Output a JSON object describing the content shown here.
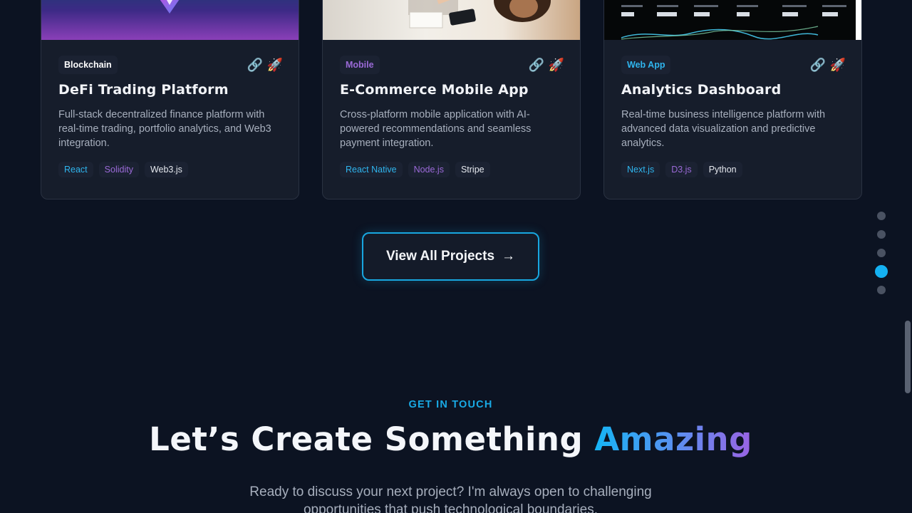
{
  "projects": [
    {
      "category": "Blockchain",
      "category_color": "#ffffff",
      "category_bg": "#1b2232",
      "title": "DeFi Trading Platform",
      "description": "Full-stack decentralized finance platform with real-time trading, portfolio analytics, and Web3 integration.",
      "tags": [
        {
          "label": "React",
          "color": "#2fb5ee"
        },
        {
          "label": "Solidity",
          "color": "#9b6ad8"
        },
        {
          "label": "Web3.js",
          "color": "#e5e8ee"
        }
      ],
      "thumb": "defi"
    },
    {
      "category": "Mobile",
      "category_color": "#9b6ad8",
      "category_bg": "#1b2232",
      "title": "E-Commerce Mobile App",
      "description": "Cross-platform mobile application with AI-powered recommendations and seamless payment integration.",
      "tags": [
        {
          "label": "React Native",
          "color": "#2fb5ee"
        },
        {
          "label": "Node.js",
          "color": "#9b6ad8"
        },
        {
          "label": "Stripe",
          "color": "#e5e8ee"
        }
      ],
      "thumb": "shop"
    },
    {
      "category": "Web App",
      "category_color": "#2fb5ee",
      "category_bg": "#1b2232",
      "title": "Analytics Dashboard",
      "description": "Real-time business intelligence platform with advanced data visualization and predictive analytics.",
      "tags": [
        {
          "label": "Next.js",
          "color": "#2fb5ee"
        },
        {
          "label": "D3.js",
          "color": "#9b6ad8"
        },
        {
          "label": "Python",
          "color": "#e5e8ee"
        }
      ],
      "thumb": "analytics"
    }
  ],
  "card_icons": {
    "link": "🔗",
    "launch": "🚀"
  },
  "view_all": {
    "label": "View All Projects",
    "arrow": "→"
  },
  "section_nav": {
    "count": 5,
    "active_index": 3
  },
  "contact": {
    "eyebrow": "GET IN TOUCH",
    "headline_plain": "Let’s Create Something ",
    "headline_accent": "Amazing",
    "lead": "Ready to discuss your next project? I'm always open to challenging opportunities that push technological boundaries."
  },
  "colors": {
    "accent": "#14b1f2",
    "purple": "#9b6ad8",
    "background": "#0c1322"
  }
}
